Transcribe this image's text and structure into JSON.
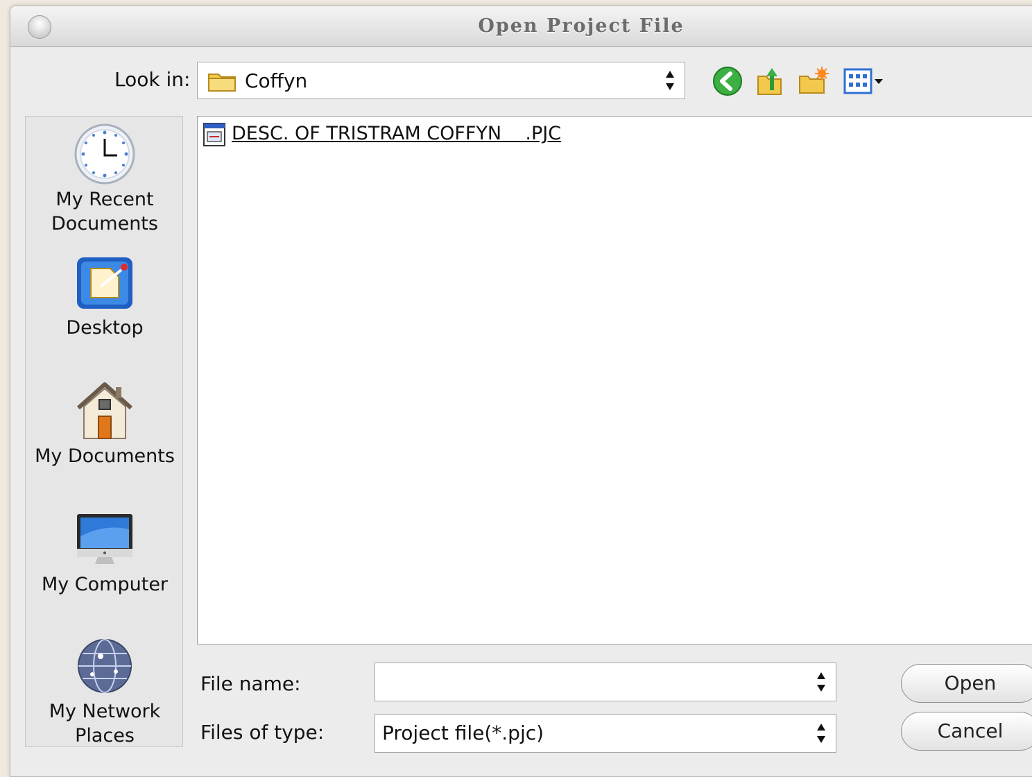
{
  "window": {
    "title": "Open Project File"
  },
  "look_in": {
    "label": "Look in:",
    "value": "Coffyn",
    "folder_icon": "folder-icon"
  },
  "toolbar": {
    "icons": [
      "back-arrow-icon",
      "up-folder-icon",
      "new-folder-icon",
      "view-menu-icon"
    ]
  },
  "places": [
    {
      "label_line1": "My Recent",
      "label_line2": "Documents",
      "icon": "clock-icon"
    },
    {
      "label_line1": "Desktop",
      "label_line2": "",
      "icon": "desktop-icon"
    },
    {
      "label_line1": "My Documents",
      "label_line2": "",
      "icon": "house-icon"
    },
    {
      "label_line1": "My Computer",
      "label_line2": "",
      "icon": "monitor-icon"
    },
    {
      "label_line1": "My Network",
      "label_line2": "Places",
      "icon": "globe-icon"
    }
  ],
  "files": [
    {
      "name": "DESC. OF TRISTRAM COFFYN    .PJC",
      "icon": "project-file-icon"
    }
  ],
  "file_name": {
    "label": "File name:",
    "value": ""
  },
  "file_type": {
    "label": "Files of type:",
    "value": "Project file(*.pjc)"
  },
  "buttons": {
    "open": "Open",
    "cancel": "Cancel"
  }
}
